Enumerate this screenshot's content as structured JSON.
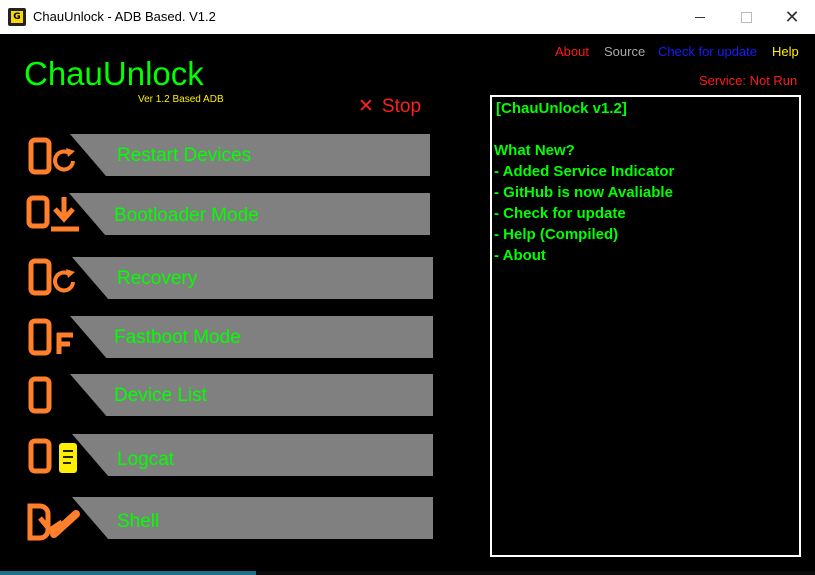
{
  "window": {
    "title": "ChauUnlock - ADB Based. V1.2",
    "icon": "app-logo-icon",
    "icon_glyph": "G"
  },
  "menu": {
    "about": "About",
    "source": "Source",
    "check_update": "Check for update",
    "help": "Help"
  },
  "service_status": "Service: Not Run",
  "app": {
    "name": "ChauUnlock",
    "version": "Ver 1.2 Based ADB"
  },
  "stop": {
    "icon": "close-x-icon",
    "glyph": "✕",
    "label": "Stop"
  },
  "buttons": [
    {
      "label": "Restart Devices",
      "icon": "restart-device-icon"
    },
    {
      "label": "Bootloader Mode",
      "icon": "bootloader-download-icon"
    },
    {
      "label": "Recovery",
      "icon": "recovery-icon"
    },
    {
      "label": "Fastboot Mode",
      "icon": "fastboot-icon"
    },
    {
      "label": "Device List",
      "icon": "device-list-icon"
    },
    {
      "label": "Logcat",
      "icon": "logcat-icon"
    },
    {
      "label": "Shell",
      "icon": "shell-icon"
    }
  ],
  "log": {
    "lines": [
      "[ChauUnlock v1.2]",
      "What New?",
      "- Added Service Indicator",
      "- GitHub is now Avaliable",
      "- Check for update",
      "- Help (Compiled)",
      "- About"
    ]
  },
  "colors": {
    "orange": "#ff7f2a",
    "green": "#00ff00",
    "red": "#ff1a1a",
    "yellow": "#ffee00",
    "blue": "#1a1aff",
    "gray": "#808080"
  }
}
